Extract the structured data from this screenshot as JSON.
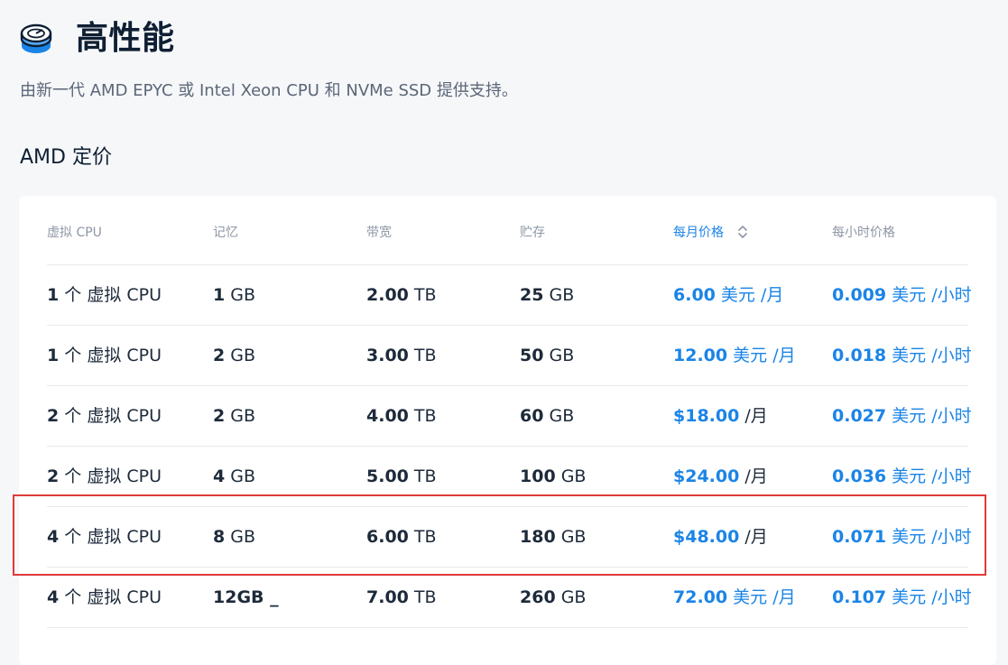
{
  "header": {
    "title": "高性能",
    "subtitle": "由新一代 AMD EPYC 或 Intel Xeon CPU 和 NVMe SSD 提供支持。",
    "icon": "server-disk-icon"
  },
  "section": {
    "title": "AMD 定价"
  },
  "table": {
    "columns": [
      "虚拟 CPU",
      "记忆",
      "带宽",
      "贮存",
      "每月价格",
      "每小时价格"
    ],
    "active_sort_column": "每月价格",
    "rows": [
      {
        "cpu": {
          "num": "1",
          "unit": " 个 虚拟 CPU"
        },
        "memory": {
          "num": "1",
          "unit": " GB"
        },
        "bandwidth": {
          "num": "2.00",
          "unit": " TB"
        },
        "storage": {
          "num": "25",
          "unit": " GB"
        },
        "monthly": {
          "num": "6.00",
          "unit": " 美元 /月"
        },
        "hourly": {
          "num": "0.009",
          "unit": " 美元 /小时"
        }
      },
      {
        "cpu": {
          "num": "1",
          "unit": " 个 虚拟 CPU"
        },
        "memory": {
          "num": "2",
          "unit": " GB"
        },
        "bandwidth": {
          "num": "3.00",
          "unit": " TB"
        },
        "storage": {
          "num": "50",
          "unit": " GB"
        },
        "monthly": {
          "num": "12.00",
          "unit": " 美元 /月"
        },
        "hourly": {
          "num": "0.018",
          "unit": " 美元 /小时"
        }
      },
      {
        "cpu": {
          "num": "2",
          "unit": " 个 虚拟 CPU"
        },
        "memory": {
          "num": "2",
          "unit": " GB"
        },
        "bandwidth": {
          "num": "4.00",
          "unit": " TB"
        },
        "storage": {
          "num": "60",
          "unit": " GB"
        },
        "monthly": {
          "num": "$18.00",
          "unit": " /月"
        },
        "hourly": {
          "num": "0.027",
          "unit": " 美元 /小时"
        }
      },
      {
        "cpu": {
          "num": "2",
          "unit": " 个 虚拟 CPU"
        },
        "memory": {
          "num": "4",
          "unit": " GB"
        },
        "bandwidth": {
          "num": "5.00",
          "unit": " TB"
        },
        "storage": {
          "num": "100",
          "unit": " GB"
        },
        "monthly": {
          "num": "$24.00",
          "unit": " /月"
        },
        "hourly": {
          "num": "0.036",
          "unit": " 美元 /小时"
        }
      },
      {
        "cpu": {
          "num": "4",
          "unit": " 个 虚拟 CPU"
        },
        "memory": {
          "num": "8",
          "unit": " GB"
        },
        "bandwidth": {
          "num": "6.00",
          "unit": " TB"
        },
        "storage": {
          "num": "180",
          "unit": " GB"
        },
        "monthly": {
          "num": "$48.00",
          "unit": " /月"
        },
        "hourly": {
          "num": "0.071",
          "unit": " 美元 /小时"
        }
      },
      {
        "cpu": {
          "num": "4",
          "unit": " 个 虚拟 CPU"
        },
        "memory": {
          "num": "12GB _",
          "unit": ""
        },
        "bandwidth": {
          "num": "7.00",
          "unit": " TB"
        },
        "storage": {
          "num": "260",
          "unit": " GB"
        },
        "monthly": {
          "num": "72.00",
          "unit": " 美元 /月"
        },
        "hourly": {
          "num": "0.107",
          "unit": " 美元 /小时"
        }
      }
    ]
  },
  "colors": {
    "accent": "#1b84e7",
    "highlight_border": "#e03a3a",
    "text_dark": "#1d2a3a",
    "text_muted": "#8e97a5"
  }
}
